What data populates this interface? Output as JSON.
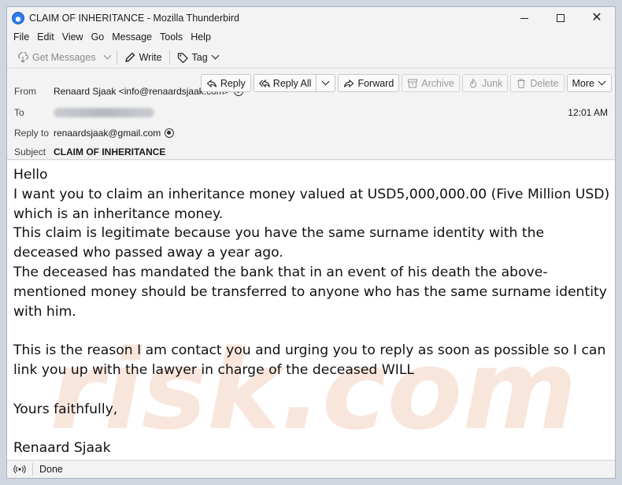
{
  "window": {
    "title": "CLAIM OF INHERITANCE - Mozilla Thunderbird"
  },
  "menu": [
    "File",
    "Edit",
    "View",
    "Go",
    "Message",
    "Tools",
    "Help"
  ],
  "toolbar": {
    "get_messages": "Get Messages",
    "write": "Write",
    "tag": "Tag"
  },
  "header": {
    "from_label": "From",
    "from_value": "Renaard Sjaak <info@renaardsjaak.com>",
    "to_label": "To",
    "reply_to_label": "Reply to",
    "reply_to_value": "renaardsjaak@gmail.com",
    "subject_label": "Subject",
    "subject_value": "CLAIM OF INHERITANCE",
    "time": "12:01 AM"
  },
  "actions": {
    "reply": "Reply",
    "reply_all": "Reply All",
    "forward": "Forward",
    "archive": "Archive",
    "junk": "Junk",
    "delete": "Delete",
    "more": "More"
  },
  "body": {
    "lines": [
      "Hello",
      "I want you to claim an inheritance money valued at USD5,000,000.00 (Five Million USD) which is an inheritance money.",
      "This claim is legitimate because you have the same surname identity with the deceased who passed away a year ago.",
      "The deceased has mandated the bank that in an event of his death the above-mentioned money should be transferred to anyone who has the same surname identity with him.",
      "",
      "This is the reason I am contact you and urging you to reply as soon as possible so I can link you up with the lawyer in charge of the deceased WILL",
      "",
      "Yours faithfully,",
      "",
      "Renaard Sjaak"
    ],
    "watermark": "risk.com"
  },
  "status": {
    "text": "Done"
  },
  "colors": {
    "window_bg": "#f3f3f3",
    "body_bg": "#ffffff",
    "watermark": "#f6e1d6"
  }
}
